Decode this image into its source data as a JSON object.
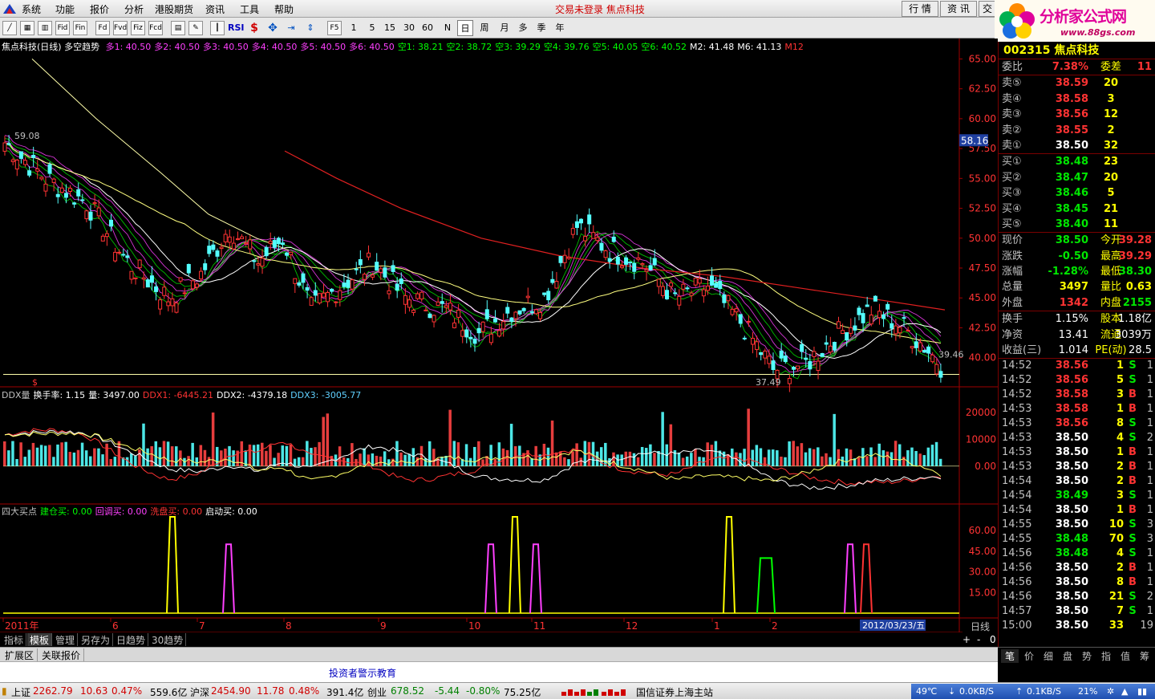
{
  "menubar": {
    "items": [
      "系统",
      "功能",
      "报价",
      "分析",
      "港股期货",
      "资讯",
      "工具",
      "帮助"
    ],
    "login_status": "交易未登录  焦点科技",
    "right_buttons": [
      "行 情",
      "资 讯",
      "交"
    ]
  },
  "toolbar": {
    "icons": [
      "line-chart-icon",
      "grid-icon",
      "bars-icon",
      "Fid",
      "Fin",
      "Fd",
      "Fiz",
      "Fcd",
      "pen-icon",
      "candle-icon",
      "RSI",
      "dollar-icon",
      "move-icon",
      "export-icon",
      "scale-icon"
    ],
    "f5": "F5",
    "periods": [
      "1",
      "5",
      "15",
      "30",
      "60",
      "N",
      "日",
      "周",
      "月",
      "多",
      "季",
      "年"
    ],
    "selected_period": "日"
  },
  "brand": {
    "title": "分析家公式网",
    "url": "www.88gs.com"
  },
  "main_chart": {
    "title": "焦点科技(日线) 多空趋势",
    "legend": [
      {
        "label": "多1: 40.50",
        "color": "#ff40ff"
      },
      {
        "label": "多2: 40.50",
        "color": "#ff40ff"
      },
      {
        "label": "多3: 40.50",
        "color": "#ff40ff"
      },
      {
        "label": "多4: 40.50",
        "color": "#ff40ff"
      },
      {
        "label": "多5: 40.50",
        "color": "#ff40ff"
      },
      {
        "label": "多6: 40.50",
        "color": "#ff40ff"
      },
      {
        "label": "空1: 38.21",
        "color": "#00ff00"
      },
      {
        "label": "空2: 38.72",
        "color": "#00ff00"
      },
      {
        "label": "空3: 39.29",
        "color": "#00ff00"
      },
      {
        "label": "空4: 39.76",
        "color": "#00ff00"
      },
      {
        "label": "空5: 40.05",
        "color": "#00ff00"
      },
      {
        "label": "空6: 40.52",
        "color": "#00ff00"
      },
      {
        "label": "M2: 41.48",
        "color": "#ffffff"
      },
      {
        "label": "M6: 41.13",
        "color": "#ffffff"
      },
      {
        "label": "M12",
        "color": "#ff3333"
      }
    ],
    "y_ticks": [
      "65.00",
      "62.50",
      "60.00",
      "57.50",
      "55.00",
      "52.50",
      "50.00",
      "47.50",
      "45.00",
      "42.50",
      "40.00"
    ],
    "y_range": [
      38.5,
      65.5
    ],
    "high_label": "59.08",
    "low_label": "37.49",
    "last_label": "39.46",
    "cursor_value": "58.16",
    "marker": "$"
  },
  "ddx_chart": {
    "legend": [
      {
        "label": "DDX量",
        "color": "#c0c0c0"
      },
      {
        "label": "换手率: 1.15",
        "color": "#ffffff"
      },
      {
        "label": "量: 3497.00",
        "color": "#ffffff"
      },
      {
        "label": "DDX1: -6445.21",
        "color": "#ff3333"
      },
      {
        "label": "DDX2: -4379.18",
        "color": "#ffffff"
      },
      {
        "label": "DDX3: -3005.77",
        "color": "#60d0ff"
      }
    ],
    "y_ticks": [
      "20000",
      "10000",
      "0.00"
    ]
  },
  "buy_chart": {
    "legend": [
      {
        "label": "四大买点",
        "color": "#c0c0c0"
      },
      {
        "label": "建仓买: 0.00",
        "color": "#00ff00"
      },
      {
        "label": "回调买: 0.00",
        "color": "#ff40ff"
      },
      {
        "label": "洗盘买: 0.00",
        "color": "#ff3333"
      },
      {
        "label": "启动买: 0.00",
        "color": "#ffffff"
      }
    ],
    "y_ticks": [
      "60.00",
      "45.00",
      "30.00",
      "15.00"
    ]
  },
  "x_axis": {
    "labels": [
      "2011年",
      "6",
      "7",
      "8",
      "9",
      "10",
      "11",
      "12",
      "1",
      "2"
    ],
    "cursor_date": "2012/03/23/五",
    "period": "日线"
  },
  "quote": {
    "code_name": "002315 焦点科技",
    "weibi_label": "委比",
    "weibi_value": "7.38%",
    "weicha_label": "委差",
    "weicha_value": "11",
    "asks": [
      {
        "label": "卖⑤",
        "price": "38.59",
        "vol": "20"
      },
      {
        "label": "卖④",
        "price": "38.58",
        "vol": "3"
      },
      {
        "label": "卖③",
        "price": "38.56",
        "vol": "12"
      },
      {
        "label": "卖②",
        "price": "38.55",
        "vol": "2"
      },
      {
        "label": "卖①",
        "price": "38.50",
        "vol": "32"
      }
    ],
    "bids": [
      {
        "label": "买①",
        "price": "38.48",
        "vol": "23"
      },
      {
        "label": "买②",
        "price": "38.47",
        "vol": "20"
      },
      {
        "label": "买③",
        "price": "38.46",
        "vol": "5"
      },
      {
        "label": "买④",
        "price": "38.45",
        "vol": "21"
      },
      {
        "label": "买⑤",
        "price": "38.40",
        "vol": "11"
      }
    ],
    "stats": [
      {
        "l1": "现价",
        "v1": "38.50",
        "c1": "g",
        "l2": "今开",
        "v2": "39.28",
        "c2": "r"
      },
      {
        "l1": "涨跌",
        "v1": "-0.50",
        "c1": "g",
        "l2": "最高",
        "v2": "39.29",
        "c2": "r"
      },
      {
        "l1": "涨幅",
        "v1": "-1.28%",
        "c1": "g",
        "l2": "最低",
        "v2": "38.30",
        "c2": "g"
      },
      {
        "l1": "总量",
        "v1": "3497",
        "c1": "y",
        "l2": "量比",
        "v2": "0.63",
        "c2": "y"
      },
      {
        "l1": "外盘",
        "v1": "1342",
        "c1": "r",
        "l2": "内盘",
        "v2": "2155",
        "c2": "g"
      }
    ],
    "stats2": [
      {
        "l1": "换手",
        "v1": "1.15%",
        "l2": "股本",
        "v2": "1.18亿"
      },
      {
        "l1": "净资",
        "v1": "13.41",
        "l2": "流通",
        "v2": "3039万"
      },
      {
        "l1": "收益(三)",
        "v1": "1.014",
        "l2": "PE(动)",
        "v2": "28.5"
      }
    ],
    "trades": [
      {
        "t": "14:52",
        "p": "38.56",
        "v": "1",
        "s": "S",
        "n": "1"
      },
      {
        "t": "14:52",
        "p": "38.56",
        "v": "5",
        "s": "S",
        "n": "1"
      },
      {
        "t": "14:52",
        "p": "38.58",
        "v": "3",
        "s": "B",
        "n": "1"
      },
      {
        "t": "14:53",
        "p": "38.58",
        "v": "1",
        "s": "B",
        "n": "1"
      },
      {
        "t": "14:53",
        "p": "38.56",
        "v": "8",
        "s": "S",
        "n": "1"
      },
      {
        "t": "14:53",
        "p": "38.50",
        "v": "4",
        "s": "S",
        "n": "2"
      },
      {
        "t": "14:53",
        "p": "38.50",
        "v": "1",
        "s": "B",
        "n": "1"
      },
      {
        "t": "14:53",
        "p": "38.50",
        "v": "2",
        "s": "B",
        "n": "1"
      },
      {
        "t": "14:54",
        "p": "38.50",
        "v": "2",
        "s": "B",
        "n": "1"
      },
      {
        "t": "14:54",
        "p": "38.49",
        "v": "3",
        "s": "S",
        "n": "1"
      },
      {
        "t": "14:54",
        "p": "38.50",
        "v": "1",
        "s": "B",
        "n": "1"
      },
      {
        "t": "14:55",
        "p": "38.50",
        "v": "10",
        "s": "S",
        "n": "3"
      },
      {
        "t": "14:55",
        "p": "38.48",
        "v": "70",
        "s": "S",
        "n": "3"
      },
      {
        "t": "14:56",
        "p": "38.48",
        "v": "4",
        "s": "S",
        "n": "1"
      },
      {
        "t": "14:56",
        "p": "38.50",
        "v": "2",
        "s": "B",
        "n": "1"
      },
      {
        "t": "14:56",
        "p": "38.50",
        "v": "8",
        "s": "B",
        "n": "1"
      },
      {
        "t": "14:56",
        "p": "38.50",
        "v": "21",
        "s": "S",
        "n": "2"
      },
      {
        "t": "14:57",
        "p": "38.50",
        "v": "7",
        "s": "S",
        "n": "1"
      },
      {
        "t": "15:00",
        "p": "38.50",
        "v": "33",
        "s": "",
        "n": "19"
      }
    ]
  },
  "bottom_tabs": [
    "指标",
    "模板",
    "管理",
    "另存为",
    "日趋势",
    "30趋势"
  ],
  "bottom_tabs_active": "模板",
  "ext_tabs": [
    "扩展区",
    "关联报价"
  ],
  "notice": "投资者警示教育",
  "right_tabs": [
    "笔",
    "价",
    "细",
    "盘",
    "势",
    "指",
    "值",
    "筹"
  ],
  "zoom_controls": [
    "+",
    "-",
    "0"
  ],
  "statusbar": {
    "sh_label": "上证",
    "sh_index": "2262.79",
    "sh_change": "10.63",
    "sh_pct": "0.47%",
    "sh_amount": "559.6亿",
    "sz_label": "沪深",
    "sz_index": "2454.90",
    "sz_change": "11.78",
    "sz_pct": "0.48%",
    "sz_amount": "391.4亿",
    "cy_label": "创业",
    "cy_index": "678.52",
    "cy_change": "-5.44",
    "cy_pct": "-0.80%",
    "cy_amount": "75.25亿",
    "server": "国信证券上海主站",
    "temp": "49℃",
    "down": "0.0KB/S",
    "up": "0.1KB/S",
    "cpu": "21%"
  }
}
